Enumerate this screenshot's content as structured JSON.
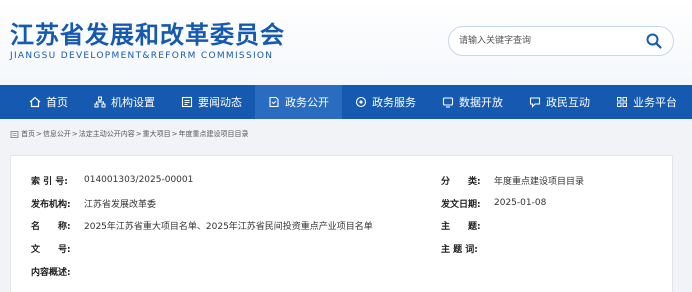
{
  "header": {
    "title": "江苏省发展和改革委员会",
    "subtitle": "JIANGSU DEVELOPMENT&REFORM COMMISSION",
    "brand_color": "#1659b0"
  },
  "search": {
    "placeholder": "请输入关键字查询",
    "button_icon": "search-icon"
  },
  "nav": {
    "items": [
      {
        "label": "首页",
        "icon": "home-icon"
      },
      {
        "label": "机构设置",
        "icon": "org-icon"
      },
      {
        "label": "要闻动态",
        "icon": "news-icon"
      },
      {
        "label": "政务公开",
        "icon": "doc-icon",
        "active": true
      },
      {
        "label": "政务服务",
        "icon": "service-icon"
      },
      {
        "label": "数据开放",
        "icon": "data-icon"
      },
      {
        "label": "政民互动",
        "icon": "chat-icon"
      },
      {
        "label": "业务平台",
        "icon": "grid-icon"
      }
    ]
  },
  "breadcrumb": [
    "首页",
    "信息公开",
    "法定主动公开内容",
    "重大项目",
    "年度重点建设项目目录"
  ],
  "meta": {
    "index_label": "索 引 号:",
    "index_value": "014001303/2025-00001",
    "category_label": "分　　类:",
    "category_value": "年度重点建设项目目录",
    "publisher_label": "发布机构:",
    "publisher_value": "江苏省发展改革委",
    "date_label": "发文日期:",
    "date_value": "2025-01-08",
    "name_label": "名　　称:",
    "name_value": "2025年江苏省重大项目名单、2025年江苏省民间投资重点产业项目名单",
    "subject_label": "主　　题:",
    "subject_value": "",
    "docnum_label": "文　　号:",
    "docnum_value": "",
    "keywords_label": "主 题 词:",
    "keywords_value": "",
    "summary_label": "内容概述:",
    "summary_value": ""
  }
}
